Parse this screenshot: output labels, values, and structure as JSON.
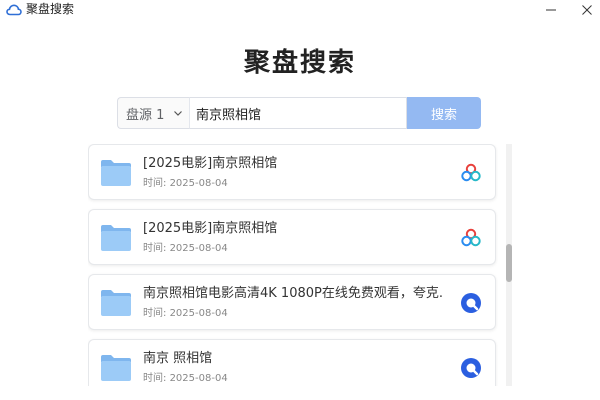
{
  "window": {
    "title": "聚盘搜索",
    "minimize_glyph": "—",
    "close_glyph": "✕"
  },
  "heading": "聚盘搜索",
  "search": {
    "source_selected": "盘源 1",
    "query": "南京照相馆",
    "button_label": "搜索"
  },
  "results": [
    {
      "title": "[2025电影]南京照相馆",
      "time_label": "时间:",
      "time": "2025-08-04",
      "source_icon": "baidu-pan-icon"
    },
    {
      "title": "[2025电影]南京照相馆",
      "time_label": "时间:",
      "time": "2025-08-04",
      "source_icon": "baidu-pan-icon"
    },
    {
      "title": "南京照相馆电影高清4K 1080P在线免费观看，夸克...",
      "time_label": "时间:",
      "time": "2025-08-04",
      "source_icon": "quark-pan-icon"
    },
    {
      "title": "南京 照相馆",
      "time_label": "时间:",
      "time": "2025-08-04",
      "source_icon": "quark-pan-icon"
    }
  ],
  "colors": {
    "accent": "#94b9f2",
    "folder": "#8cc3f5",
    "quark": "#2b5fe0"
  }
}
